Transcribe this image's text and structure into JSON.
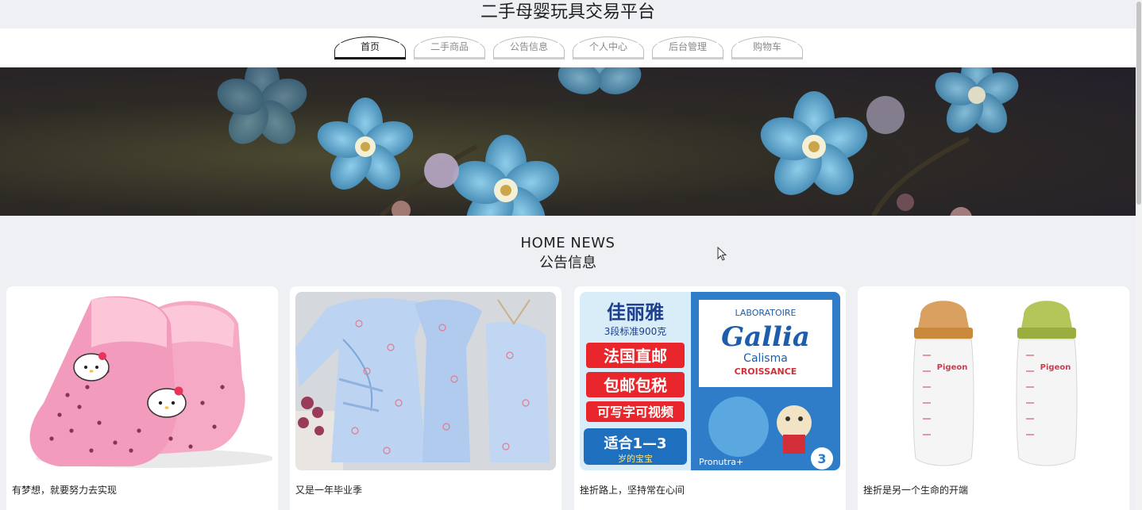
{
  "site": {
    "title": "二手母婴玩具交易平台"
  },
  "nav": {
    "items": [
      {
        "label": "首页",
        "active": true
      },
      {
        "label": "二手商品",
        "active": false
      },
      {
        "label": "公告信息",
        "active": false
      },
      {
        "label": "个人中心",
        "active": false
      },
      {
        "label": "后台管理",
        "active": false
      },
      {
        "label": "购物车",
        "active": false
      }
    ]
  },
  "section": {
    "title_en": "HOME NEWS",
    "title_zh": "公告信息"
  },
  "news": [
    {
      "title": "有梦想，就要努力去实现"
    },
    {
      "title": "又是一年毕业季"
    },
    {
      "title": "挫折路上，坚持常在心间",
      "image_text": {
        "brand_zh": "佳丽雅",
        "spec": "3段标准900克",
        "tag1": "法国直邮",
        "tag2": "包邮包税",
        "tag3": "可写字可视频",
        "age": "适合1—3",
        "age_sub": "岁的宝宝",
        "lab": "LABORATOIRE",
        "brand": "Gallia",
        "line": "Calisma",
        "sub": "CROISSANCE",
        "footer": "Pronutra+",
        "stage": "3"
      }
    },
    {
      "title": "挫折是另一个生命的开端",
      "image_text": {
        "bottle_brand": "Pigeon"
      }
    }
  ],
  "colors": {
    "page_bg": "#eef0f4",
    "card_bg": "#ffffff",
    "nav_active": "#222222",
    "nav_inactive": "#8a8a8a"
  }
}
